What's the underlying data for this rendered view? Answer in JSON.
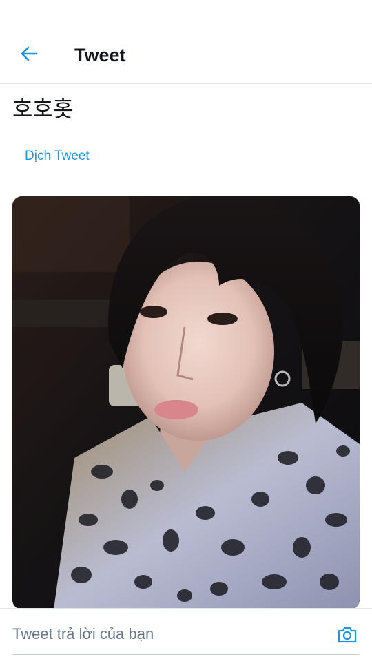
{
  "header": {
    "back_icon": "arrow-left-icon",
    "title": "Tweet"
  },
  "tweet": {
    "text": "호호홋",
    "translate_label": "Dịch Tweet",
    "media": {
      "kind": "photo",
      "description_icon": "photo"
    }
  },
  "reply": {
    "placeholder": "Tweet trả lời của bạn",
    "camera_icon": "camera-icon"
  },
  "colors": {
    "accent": "#1b95e0",
    "text": "#14171a",
    "muted": "#657786",
    "divider": "#e1e8ed"
  }
}
